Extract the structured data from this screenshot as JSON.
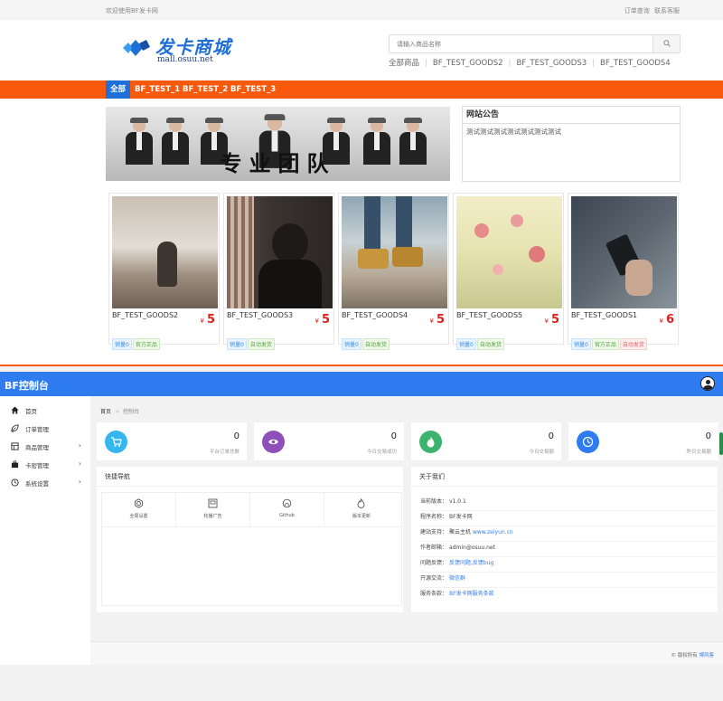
{
  "store": {
    "topbar": {
      "welcome": "欢迎使用BF发卡网",
      "links": [
        "订单查询",
        "联系客服"
      ]
    },
    "logo": {
      "title": "发卡商城",
      "subtitle": "mall.osuu.net",
      "icon": "diamond-logo-icon"
    },
    "search": {
      "placeholder": "请输入商品名称",
      "icon": "search-icon"
    },
    "quicklinks": [
      "全部商品",
      "BF_TEST_GOODS2",
      "BF_TEST_GOODS3",
      "BF_TEST_GOODS4"
    ],
    "nav": [
      {
        "label": "全部",
        "active": true
      },
      {
        "label": "BF_TEST_1",
        "active": false
      },
      {
        "label": "BF_TEST_2",
        "active": false
      },
      {
        "label": "BF_TEST_3",
        "active": false
      }
    ],
    "banner": {
      "caption": "专业团队"
    },
    "notice": {
      "title": "网站公告",
      "body": "测试测试测试测试测试测试测试"
    },
    "goods": [
      {
        "name": "BF_TEST_GOODS2",
        "currency": "¥",
        "price": "5",
        "tags": [
          {
            "text": "销量0",
            "color": "blue"
          },
          {
            "text": "官方正品",
            "color": "green"
          }
        ]
      },
      {
        "name": "BF_TEST_GOODS3",
        "currency": "¥",
        "price": "5",
        "tags": [
          {
            "text": "销量0",
            "color": "blue"
          },
          {
            "text": "自动发货",
            "color": "green"
          }
        ]
      },
      {
        "name": "BF_TEST_GOODS4",
        "currency": "¥",
        "price": "5",
        "tags": [
          {
            "text": "销量0",
            "color": "blue"
          },
          {
            "text": "自动发货",
            "color": "green"
          }
        ]
      },
      {
        "name": "BF_TEST_GOODS5",
        "currency": "¥",
        "price": "5",
        "tags": [
          {
            "text": "销量0",
            "color": "blue"
          },
          {
            "text": "自动发货",
            "color": "green"
          }
        ]
      },
      {
        "name": "BF_TEST_GOODS1",
        "currency": "¥",
        "price": "6",
        "tags": [
          {
            "text": "销量0",
            "color": "blue"
          },
          {
            "text": "官方正品",
            "color": "green"
          },
          {
            "text": "自动发货",
            "color": "red"
          }
        ]
      }
    ],
    "colors": {
      "accent": "#f85a0d",
      "brand": "#1e6fd8",
      "price": "#e02020"
    }
  },
  "admin": {
    "title": "BF控制台",
    "avatar_icon": "user-avatar-icon",
    "sidebar": [
      {
        "label": "首页",
        "icon": "home-icon",
        "expandable": false
      },
      {
        "label": "订单管理",
        "icon": "leaf-icon",
        "expandable": false
      },
      {
        "label": "商品管理",
        "icon": "grid-icon",
        "expandable": true
      },
      {
        "label": "卡密管理",
        "icon": "briefcase-icon",
        "expandable": true
      },
      {
        "label": "系统设置",
        "icon": "clock-icon",
        "expandable": true
      }
    ],
    "breadcrumb": {
      "home": "首页",
      "current": "控制台"
    },
    "stats": [
      {
        "value": "0",
        "label": "平台订单总数",
        "color": "#35b6ee",
        "icon": "cart-icon"
      },
      {
        "value": "0",
        "label": "今日交易成功",
        "color": "#8e50b8",
        "icon": "eye-icon"
      },
      {
        "value": "0",
        "label": "今日交易额",
        "color": "#3cb46e",
        "icon": "flame-icon"
      },
      {
        "value": "0",
        "label": "昨日交易额",
        "color": "#2f7cf0",
        "icon": "clock-icon"
      }
    ],
    "quick_nav": {
      "title": "快捷导航",
      "items": [
        {
          "label": "全局设置",
          "icon": "gear-icon"
        },
        {
          "label": "轮播广告",
          "icon": "image-icon"
        },
        {
          "label": "Github",
          "icon": "github-icon"
        },
        {
          "label": "版本更新",
          "icon": "fire-icon"
        }
      ]
    },
    "about": {
      "title": "关于我们",
      "rows": [
        {
          "label": "当前版本：",
          "value": "v1.0.1",
          "link": ""
        },
        {
          "label": "程序名称：",
          "value": "BF发卡网",
          "link": ""
        },
        {
          "label": "建站支持：",
          "value": "聚云主机 ",
          "link": "www.zeiyun.cn"
        },
        {
          "label": "作者邮箱：",
          "value": "admin@osuu.net",
          "link": ""
        },
        {
          "label": "问题反馈：",
          "value": "",
          "link": "反馈问题,反馈bug"
        },
        {
          "label": "开源交流：",
          "value": "",
          "link": "微信群"
        },
        {
          "label": "服务条款：",
          "value": "",
          "link": "BF发卡网服务条款"
        }
      ]
    },
    "footer": {
      "text": "© 版权所有 ",
      "link": "博风客"
    }
  }
}
